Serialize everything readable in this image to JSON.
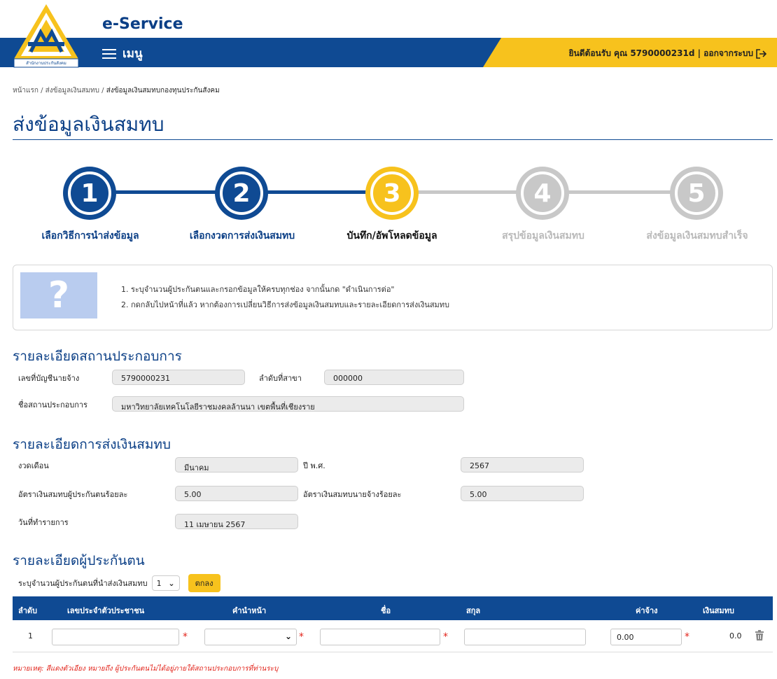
{
  "header": {
    "brand": "e-Service",
    "logo_caption": "สำนักงานประกันสังคม",
    "menu_label": "เมนู",
    "welcome": "ยินดีต้อนรับ คุณ 5790000231d | ออกจากระบบ",
    "logout_icon": "logout-icon"
  },
  "breadcrumb": {
    "home": "หน้าแรก",
    "sep": " / ",
    "level2": "ส่งข้อมูลเงินสมทบ",
    "current": "ส่งข้อมูลเงินสมทบกองทุนประกันสังคม"
  },
  "page_title": "ส่งข้อมูลเงินสมทบ",
  "stepper": {
    "steps": [
      {
        "number": "1",
        "label": "เลือกวิธีการนำส่งข้อมูล",
        "state": "done"
      },
      {
        "number": "2",
        "label": "เลือกงวดการส่งเงินสมทบ",
        "state": "done"
      },
      {
        "number": "3",
        "label": "บันทึก/อัพโหลดข้อมูล",
        "state": "current"
      },
      {
        "number": "4",
        "label": "สรุปข้อมูลเงินสมทบ",
        "state": "pending"
      },
      {
        "number": "5",
        "label": "ส่งข้อมูลเงินสมทบสำเร็จ",
        "state": "pending"
      }
    ],
    "colors": {
      "done": "#0f4a93",
      "current": "#f7c21d",
      "pending": "#c8c8c8"
    }
  },
  "info": {
    "icon": "question-icon",
    "lines": [
      "1. ระบุจำนวนผู้ประกันตนและกรอกข้อมูลให้ครบทุกช่อง จากนั้นกด \"ดำเนินการต่อ\"",
      "2. กดกลับไปหน้าที่แล้ว หากต้องการเปลี่ยนวิธีการส่งข้อมูลเงินสมทบและรายละเอียดการส่งเงินสมทบ"
    ]
  },
  "establishment": {
    "title": "รายละเอียดสถานประกอบการ",
    "account_label": "เลขที่บัญชีนายจ้าง",
    "account_value": "5790000231",
    "branch_label": "ลำดับที่สาขา",
    "branch_value": "000000",
    "name_label": "ชื่อสถานประกอบการ",
    "name_value": "มหาวิทยาลัยเทคโนโลยีราชมงคลล้านนา เขตพื้นที่เชียงราย"
  },
  "remittance": {
    "title": "รายละเอียดการส่งเงินสมทบ",
    "month_label": "งวดเดือน",
    "month_value": "มีนาคม",
    "year_label": "ปี พ.ศ.",
    "year_value": "2567",
    "insured_rate_label": "อัตราเงินสมทบผู้ประกันตนร้อยละ",
    "insured_rate_value": "5.00",
    "employer_rate_label": "อัตราเงินสมทบนายจ้างร้อยละ",
    "employer_rate_value": "5.00",
    "date_label": "วันที่ทำรายการ",
    "date_value": "11 เมษายน 2567"
  },
  "insured": {
    "title": "รายละเอียดผู้ประกันตน",
    "count_label": "ระบุจำนวนผู้ประกันตนที่นำส่งเงินสมทบ",
    "count_value": "1",
    "ok_label": "ตกลง",
    "columns": [
      "ลำดับ",
      "เลขประจำตัวประชาชน",
      "คำนำหน้า",
      "ชื่อ",
      "สกุล",
      "ค่าจ้าง",
      "เงินสมทบ"
    ],
    "rows": [
      {
        "index": "1",
        "national_id": "",
        "prefix": "",
        "first_name": "",
        "last_name": "",
        "wage": "0.00",
        "contribution": "0.0"
      }
    ],
    "note": "หมายเหตุ: สีแดงตัวเอียง หมายถึง ผู้ประกันตนไม่ได้อยู่ภายใต้สถานประกอบการที่ท่านระบุ"
  }
}
